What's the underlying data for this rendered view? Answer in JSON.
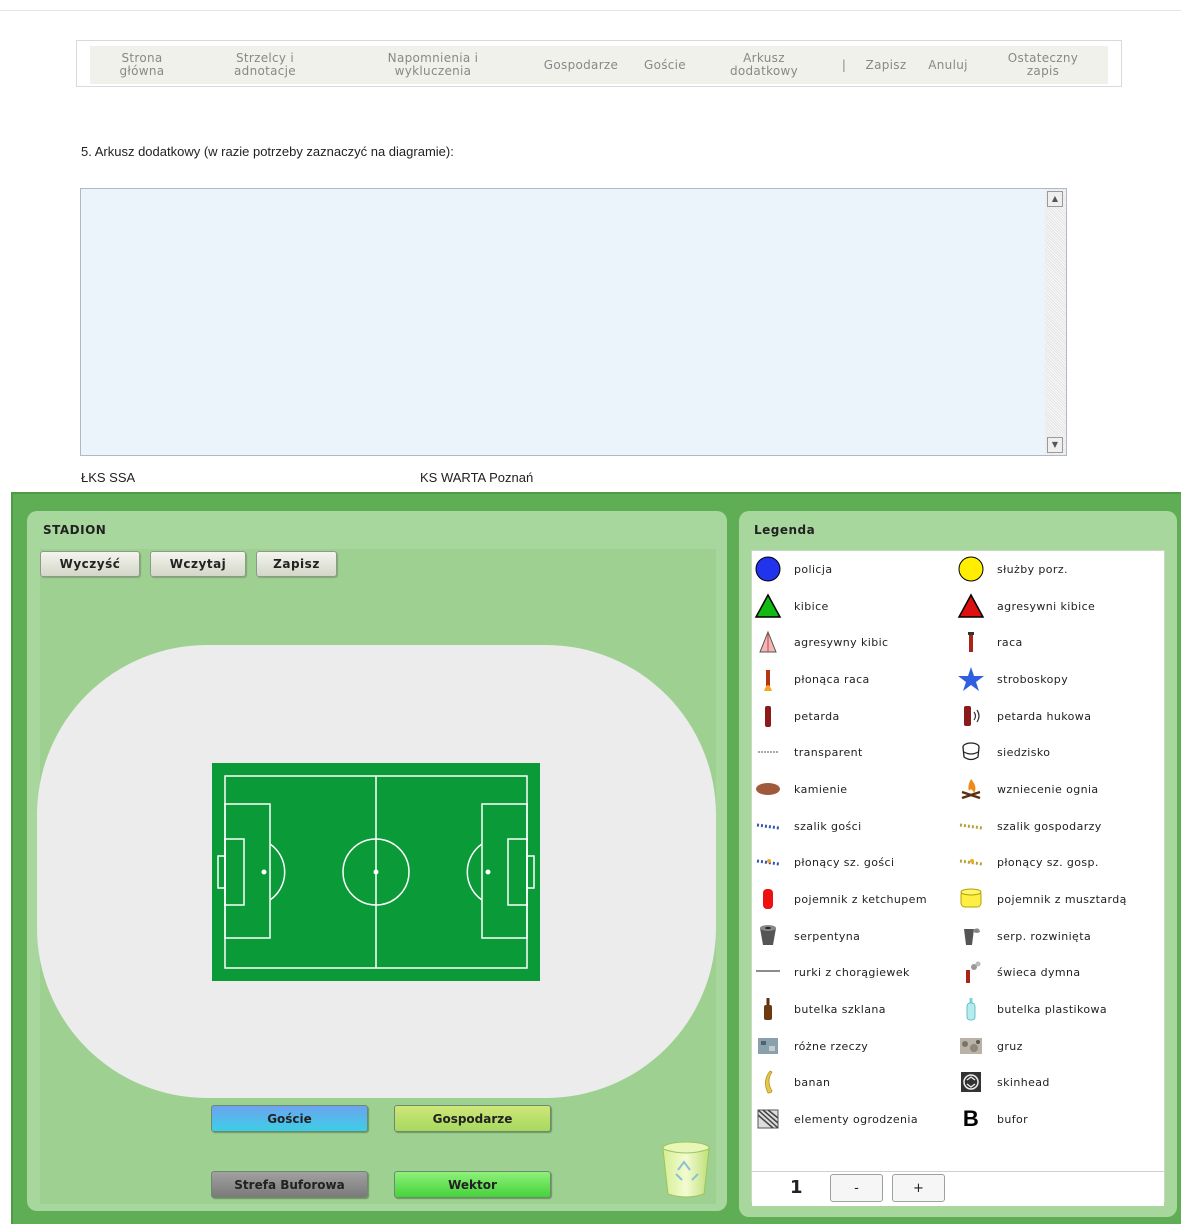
{
  "nav": {
    "items": [
      {
        "label": "Strona\ngłówna"
      },
      {
        "label": "Strzelcy i\nadnotacje"
      },
      {
        "label": "Napomnienia i\nwykluczenia"
      },
      {
        "label": "Gospodarze"
      },
      {
        "label": "Goście"
      },
      {
        "label": "Arkusz\ndodatkowy"
      },
      {
        "label": "|"
      },
      {
        "label": "Zapisz"
      },
      {
        "label": "Anuluj"
      },
      {
        "label": "Ostateczny\nzapis"
      }
    ]
  },
  "section": {
    "title": "5. Arkusz dodatkowy (w razie potrzeby zaznaczyć na diagramie):"
  },
  "notes": {
    "value": ""
  },
  "teams": {
    "home": "ŁKS SSA",
    "away": "KS WARTA Poznań"
  },
  "stadium": {
    "title": "STADION",
    "toolbar": {
      "clear": "Wyczyść",
      "load": "Wczytaj",
      "save": "Zapisz"
    },
    "modes": {
      "guests": "Goście",
      "hosts": "Gospodarze",
      "buffer": "Strefa Buforowa",
      "vector": "Wektor"
    }
  },
  "legend": {
    "title": "Legenda",
    "left": [
      {
        "icon": "blue-circle-icon",
        "label": "policja"
      },
      {
        "icon": "green-triangle-icon",
        "label": "kibice"
      },
      {
        "icon": "striped-triangle-icon",
        "label": "agresywny kibic"
      },
      {
        "icon": "burning-flare-icon",
        "label": "płonąca raca"
      },
      {
        "icon": "firecracker-icon",
        "label": "petarda"
      },
      {
        "icon": "banner-icon",
        "label": "transparent"
      },
      {
        "icon": "stones-icon",
        "label": "kamienie"
      },
      {
        "icon": "guest-scarf-icon",
        "label": "szalik gości"
      },
      {
        "icon": "burning-guest-scarf-icon",
        "label": "płonący sz. gości"
      },
      {
        "icon": "ketchup-container-icon",
        "label": "pojemnik z ketchupem"
      },
      {
        "icon": "streamer-roll-icon",
        "label": "serpentyna"
      },
      {
        "icon": "flag-tube-icon",
        "label": "rurki z chorągiewek"
      },
      {
        "icon": "glass-bottle-icon",
        "label": "butelka szklana"
      },
      {
        "icon": "various-items-icon",
        "label": "różne rzeczy"
      },
      {
        "icon": "banana-icon",
        "label": "banan"
      },
      {
        "icon": "fence-parts-icon",
        "label": "elementy ogrodzenia"
      }
    ],
    "right": [
      {
        "icon": "yellow-circle-icon",
        "label": "służby porz."
      },
      {
        "icon": "red-triangle-icon",
        "label": "agresywni kibice"
      },
      {
        "icon": "flare-icon",
        "label": "raca"
      },
      {
        "icon": "star-icon",
        "label": "stroboskopy"
      },
      {
        "icon": "sound-firecracker-icon",
        "label": "petarda hukowa"
      },
      {
        "icon": "seat-icon",
        "label": "siedzisko"
      },
      {
        "icon": "fire-icon",
        "label": "wzniecenie ognia"
      },
      {
        "icon": "host-scarf-icon",
        "label": "szalik gospodarzy"
      },
      {
        "icon": "burning-host-scarf-icon",
        "label": "płonący sz. gosp."
      },
      {
        "icon": "mustard-container-icon",
        "label": "pojemnik z musztardą"
      },
      {
        "icon": "unrolled-streamer-icon",
        "label": "serp. rozwinięta"
      },
      {
        "icon": "smoke-candle-icon",
        "label": "świeca dymna"
      },
      {
        "icon": "plastic-bottle-icon",
        "label": "butelka plastikowa"
      },
      {
        "icon": "rubble-icon",
        "label": "gruz"
      },
      {
        "icon": "skinhead-icon",
        "label": "skinhead"
      },
      {
        "icon": "buffer-b-icon",
        "label": "bufor"
      }
    ],
    "page": "1",
    "minus": "-",
    "plus": "+"
  },
  "colors": {
    "police": "#2233ee",
    "services": "#ffee00",
    "fans": "#11bb11",
    "aggressive": "#dd1111",
    "pitch": "#0a9a37",
    "green_bg": "#5fae56"
  }
}
